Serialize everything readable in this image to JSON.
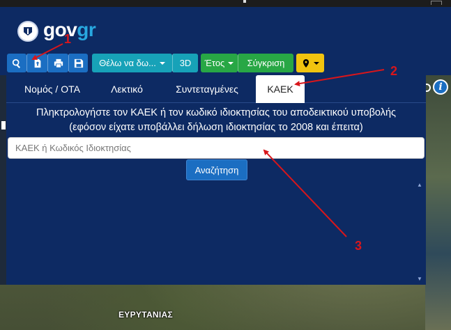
{
  "header": {
    "logo_main": "gov",
    "logo_accent": "gr"
  },
  "toolbar": {
    "search_icon": "search-icon",
    "upload_icon": "upload-icon",
    "print_icon": "print-icon",
    "save_icon": "save-icon",
    "view_dropdown_label": "Θέλω να δω...",
    "button_3d_label": "3D",
    "year_dropdown_label": "Έτος",
    "compare_label": "Σύγκριση",
    "location_icon": "map-marker-icon"
  },
  "panel": {
    "tabs": [
      {
        "label": "Νομός / ΟΤΑ",
        "active": false
      },
      {
        "label": "Λεκτικό",
        "active": false
      },
      {
        "label": "Συντεταγμένες",
        "active": false
      },
      {
        "label": "ΚΑΕΚ",
        "active": true
      }
    ],
    "instruction_line1": "Πληκτρολογήστε τον ΚΑΕΚ ή τον κωδικό ιδιοκτησίας του αποδεικτικού υποβολής",
    "instruction_line2": "(εφόσον είχατε υποβάλλει δήλωση ιδιοκτησίας το 2008 και έπειτα)",
    "search_placeholder": "ΚΑΕΚ ή Κωδικός Ιδιοκτησίας",
    "search_value": "",
    "search_button_label": "Αναζήτηση"
  },
  "map": {
    "region_label": "ΕΥΡΥΤΑΝΙΑΣ",
    "info_icon_glyph": "i"
  },
  "annotations": {
    "labels": [
      "1",
      "2",
      "3"
    ],
    "color": "#d8161b"
  },
  "colors": {
    "header_bg": "#0d2a63",
    "primary_blue": "#1b6ec2",
    "teal": "#17a2b8",
    "green": "#28a745",
    "yellow": "#f1c40f",
    "logo_accent": "#28a8e0"
  }
}
